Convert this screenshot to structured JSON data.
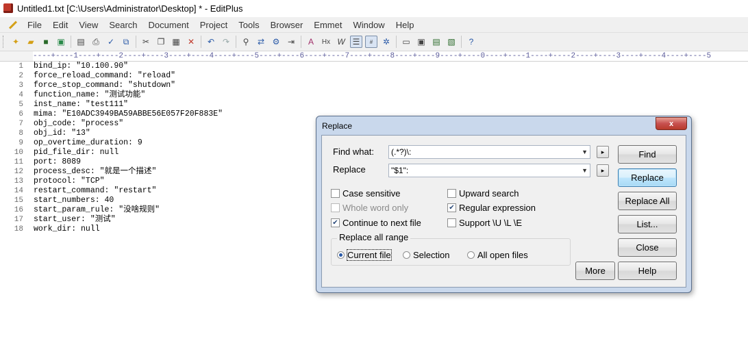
{
  "window": {
    "title": "Untitled1.txt [C:\\Users\\Administrator\\Desktop] * - EditPlus"
  },
  "menu": [
    "File",
    "Edit",
    "View",
    "Search",
    "Document",
    "Project",
    "Tools",
    "Browser",
    "Emmet",
    "Window",
    "Help"
  ],
  "ruler": "----+----1----+----2----+----3----+----4----+----5----+----6----+----7----+----8----+----9----+----0----+----1----+----2----+----3----+----4----+----5",
  "toolbar_icons": [
    "new-file-icon",
    "open-icon",
    "save-icon",
    "save-all-icon",
    "print-preview-icon",
    "print-icon",
    "spell-check-icon",
    "browser-icon",
    "cut-icon",
    "copy-icon",
    "paste-icon",
    "delete-icon",
    "undo-icon",
    "redo-icon",
    "find-icon",
    "replace-icon",
    "find-in-files-icon",
    "go-to-line-icon",
    "font-icon",
    "hex-icon",
    "word-wrap-icon",
    "ruler-icon",
    "line-number-icon",
    "settings-icon",
    "window-1-icon",
    "window-2-icon",
    "window-3-icon",
    "window-4-icon",
    "help-icon"
  ],
  "editor": {
    "lines": [
      "bind_ip: \"10.100.90\"",
      "force_reload_command: \"reload\"",
      "force_stop_command: \"shutdown\"",
      "function_name: \"测试功能\"",
      "inst_name: \"test111\"",
      "mima: \"E10ADC3949BA59ABBE56E057F20F883E\"",
      "obj_code: \"process\"",
      "obj_id: \"13\"",
      "op_overtime_duration: 9",
      "pid_file_dir: null",
      "port: 8089",
      "process_desc: \"就是一个描述\"",
      "protocol: \"TCP\"",
      "restart_command: \"restart\"",
      "start_numbers: 40",
      "start_param_rule: \"没啥规则\"",
      "start_user: \"测试\"",
      "work_dir: null"
    ],
    "line_numbers": [
      "1",
      "2",
      "3",
      "4",
      "5",
      "6",
      "7",
      "8",
      "9",
      "10",
      "11",
      "12",
      "13",
      "14",
      "15",
      "16",
      "17",
      "18"
    ]
  },
  "dialog": {
    "title": "Replace",
    "close_label": "x",
    "find_what_label": "Find what:",
    "find_what_value": "(.*?)\\:",
    "replace_label": "Replace",
    "replace_value": "\"$1\":",
    "options": {
      "case_sensitive": {
        "label": "Case sensitive",
        "checked": false
      },
      "upward_search": {
        "label": "Upward search",
        "checked": false
      },
      "whole_word": {
        "label": "Whole word only",
        "checked": false,
        "disabled": true
      },
      "regex": {
        "label": "Regular expression",
        "checked": true
      },
      "continue_next": {
        "label": "Continue to next file",
        "checked": true
      },
      "support_ule": {
        "label": "Support \\U \\L \\E",
        "checked": false
      }
    },
    "range": {
      "title": "Replace all range",
      "current_file": "Current file",
      "selection": "Selection",
      "all_open_files": "All open files",
      "selected": "current_file"
    },
    "buttons": {
      "find": "Find",
      "replace": "Replace",
      "replace_all": "Replace All",
      "list": "List...",
      "close": "Close",
      "more": "More",
      "help": "Help"
    }
  }
}
